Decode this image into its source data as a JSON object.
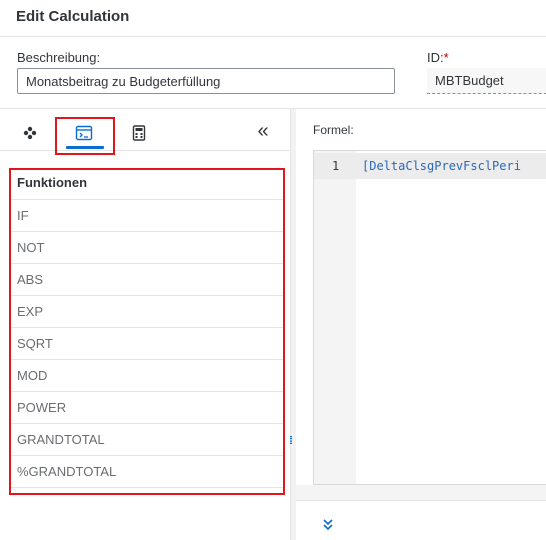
{
  "dialog": {
    "title": "Edit Calculation"
  },
  "form": {
    "description_label": "Beschreibung:",
    "description_value": "Monatsbeitrag zu Budgeterfüllung",
    "id_label": "ID:",
    "id_required_marker": "*",
    "id_value": "MBTBudget"
  },
  "left_panel": {
    "tabs": [
      {
        "icon": "cube-icon"
      },
      {
        "icon": "function-icon",
        "selected": true
      },
      {
        "icon": "calculator-icon"
      }
    ],
    "collapse_icon": "«",
    "list_header": "Funktionen",
    "functions": [
      "IF",
      "NOT",
      "ABS",
      "EXP",
      "SQRT",
      "MOD",
      "POWER",
      "GRANDTOTAL",
      "%GRANDTOTAL"
    ]
  },
  "editor": {
    "label": "Formel:",
    "line_number": "1",
    "code": "[DeltaClsgPrevFsclPeri"
  },
  "footer": {
    "expand_icon": "chevron-double-down-icon"
  },
  "colors": {
    "accent": "#0a6ed1",
    "highlight": "#e0161b",
    "code": "#2a68b8"
  }
}
